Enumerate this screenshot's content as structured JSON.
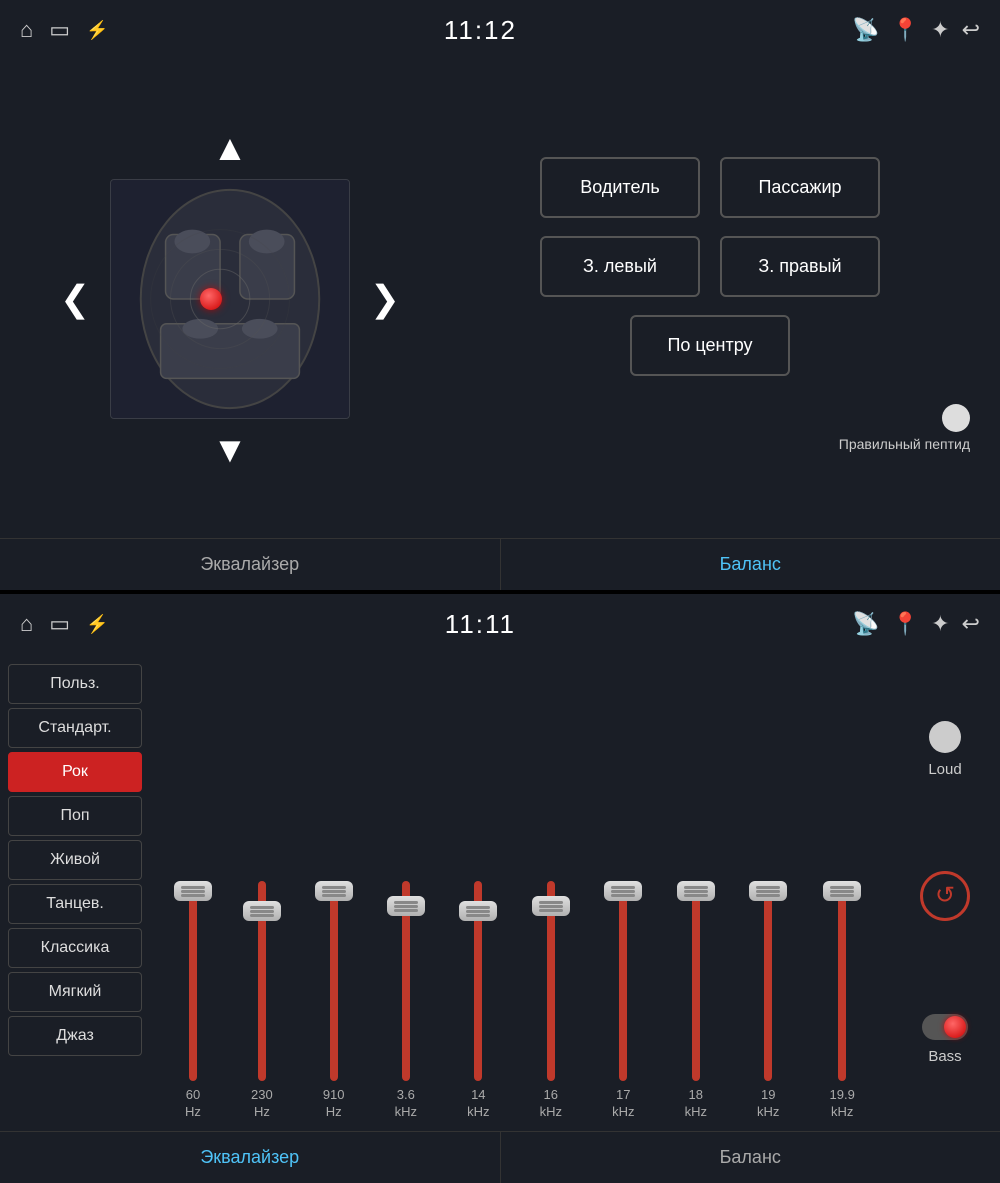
{
  "top": {
    "status_bar": {
      "time": "11:12",
      "icons_left": [
        "home-icon",
        "screen-icon",
        "usb-icon"
      ],
      "icons_right": [
        "cast-icon",
        "location-icon",
        "bluetooth-icon",
        "back-icon"
      ]
    },
    "nav_arrows": {
      "up": "▲",
      "down": "▼",
      "left": "❮",
      "right": "❯"
    },
    "buttons": {
      "driver": "Водитель",
      "passenger": "Пассажир",
      "rear_left": "З. левый",
      "rear_right": "З. правый",
      "center": "По центру"
    },
    "fader_label": "Правильный пептид",
    "tabs": {
      "equalizer": "Эквалайзер",
      "balance": "Баланс",
      "active_tab": "balance"
    }
  },
  "bottom": {
    "status_bar": {
      "time": "11:11",
      "icons_left": [
        "home-icon",
        "screen-icon",
        "usb-icon"
      ],
      "icons_right": [
        "cast-icon",
        "location-icon",
        "bluetooth-icon",
        "back-icon"
      ]
    },
    "presets": [
      {
        "id": "polz",
        "label": "Польз.",
        "active": false
      },
      {
        "id": "standart",
        "label": "Стандарт.",
        "active": false
      },
      {
        "id": "rok",
        "label": "Рок",
        "active": true
      },
      {
        "id": "pop",
        "label": "Поп",
        "active": false
      },
      {
        "id": "live",
        "label": "Живой",
        "active": false
      },
      {
        "id": "dance",
        "label": "Танцев.",
        "active": false
      },
      {
        "id": "classic",
        "label": "Классика",
        "active": false
      },
      {
        "id": "soft",
        "label": "Мягкий",
        "active": false
      },
      {
        "id": "jazz",
        "label": "Джаз",
        "active": false
      }
    ],
    "eq_bands": [
      {
        "freq": "60",
        "unit": "Hz",
        "level": 0
      },
      {
        "freq": "230",
        "unit": "Hz",
        "level": -20
      },
      {
        "freq": "910",
        "unit": "Hz",
        "level": 0
      },
      {
        "freq": "3.6",
        "unit": "kHz",
        "level": -15
      },
      {
        "freq": "14",
        "unit": "kHz",
        "level": -20
      },
      {
        "freq": "16",
        "unit": "kHz",
        "level": -15
      },
      {
        "freq": "17",
        "unit": "kHz",
        "level": 0
      },
      {
        "freq": "18",
        "unit": "kHz",
        "level": 0
      },
      {
        "freq": "19",
        "unit": "kHz",
        "level": 0
      },
      {
        "freq": "19.9",
        "unit": "kHz",
        "level": 0
      }
    ],
    "loud_label": "Loud",
    "bass_label": "Bass",
    "tabs": {
      "equalizer": "Эквалайзер",
      "balance": "Баланс",
      "active_tab": "equalizer"
    }
  }
}
